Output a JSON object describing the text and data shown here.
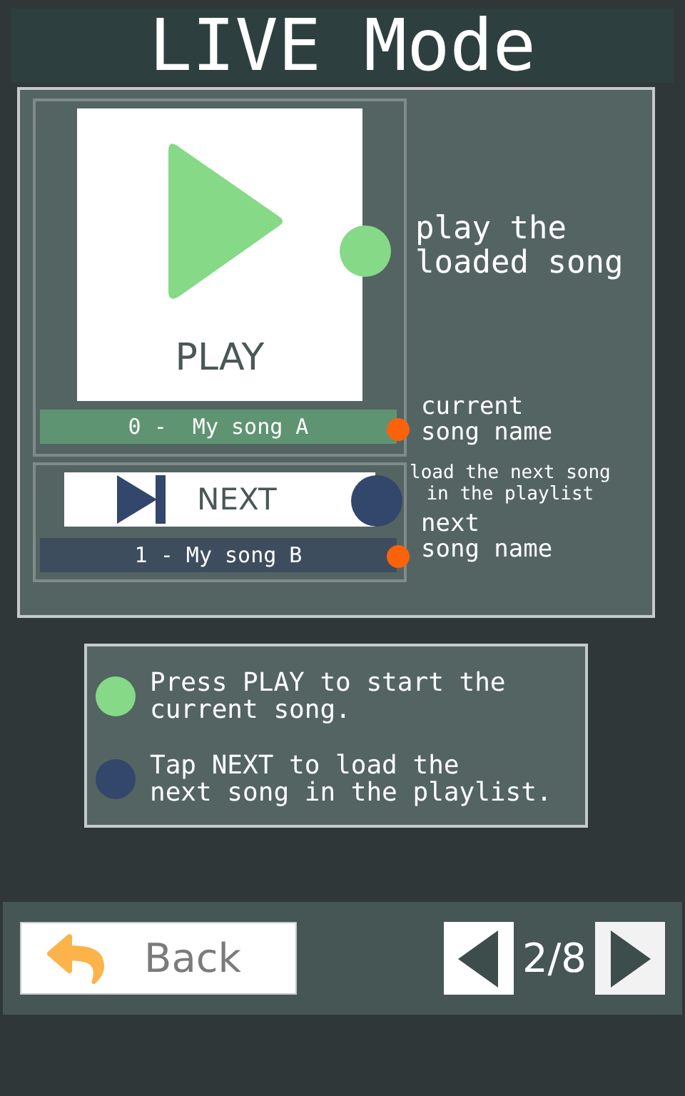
{
  "title": "LIVE Mode",
  "demo": {
    "play_button": {
      "label": "PLAY"
    },
    "play_hint": [
      "play the",
      "loaded song"
    ],
    "current_song": "0 -  My song A",
    "current_hint": [
      "current",
      "song name"
    ],
    "next_button": {
      "label": "NEXT"
    },
    "next_hint": [
      "load the next song",
      "in the playlist"
    ],
    "next_song": "1 - My song B",
    "next_song_hint": [
      "next",
      "song name"
    ]
  },
  "legend": [
    {
      "lines": [
        "Press PLAY to start the",
        "current song."
      ],
      "color": "#85d987"
    },
    {
      "lines": [
        "Tap NEXT to load the",
        "next song in the playlist."
      ],
      "color": "#33466b"
    }
  ],
  "footer": {
    "back": "Back",
    "page": "2/8"
  }
}
